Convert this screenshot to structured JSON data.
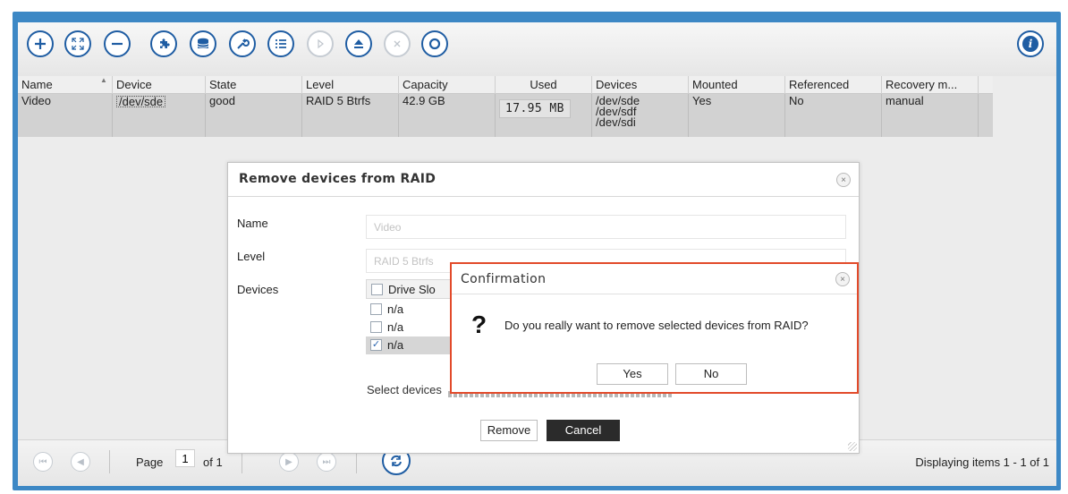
{
  "toolbar": {
    "buttons": [
      {
        "name": "add-icon"
      },
      {
        "name": "expand-icon"
      },
      {
        "name": "remove-icon"
      },
      {
        "name": "puzzle-icon"
      },
      {
        "name": "database-icon"
      },
      {
        "name": "wrench-icon"
      },
      {
        "name": "list-icon"
      },
      {
        "name": "play-icon"
      },
      {
        "name": "eject-icon"
      },
      {
        "name": "cancel-icon"
      },
      {
        "name": "refresh-icon"
      }
    ],
    "info_icon": "info-icon",
    "info_glyph": "i"
  },
  "grid": {
    "columns": [
      "Name",
      "Device",
      "State",
      "Level",
      "Capacity",
      "Used",
      "Devices",
      "Mounted",
      "Referenced",
      "Recovery m..."
    ],
    "rows": [
      {
        "name": "Video",
        "device": "/dev/sde",
        "state": "good",
        "level": "RAID 5 Btrfs",
        "capacity": "42.9 GB",
        "used": "17.95 MB",
        "devices": [
          "/dev/sde",
          "/dev/sdf",
          "/dev/sdi"
        ],
        "mounted": "Yes",
        "referenced": "No",
        "recovery": "manual"
      }
    ]
  },
  "pager": {
    "page_label": "Page",
    "page_value": "1",
    "of_label": "of 1",
    "display_text": "Displaying items 1 - 1 of 1"
  },
  "remove_dialog": {
    "title": "Remove devices from RAID",
    "name_label": "Name",
    "name_value": "Video",
    "level_label": "Level",
    "level_value": "RAID 5 Btrfs",
    "devices_label": "Devices",
    "table_header": "Drive Slo",
    "device_rows": [
      {
        "label": "n/a",
        "checked": false
      },
      {
        "label": "n/a",
        "checked": false
      },
      {
        "label": "n/a",
        "checked": true
      }
    ],
    "hint": "Select devices",
    "remove_button": "Remove",
    "cancel_button": "Cancel",
    "close_glyph": "×"
  },
  "confirmation": {
    "title": "Confirmation",
    "icon": "question-icon",
    "icon_glyph": "?",
    "message": "Do you really want to remove selected devices from RAID?",
    "yes_button": "Yes",
    "no_button": "No",
    "close_glyph": "×"
  },
  "colors": {
    "accent": "#1f5da3",
    "frame": "#3d88c5",
    "highlight_border": "#e24a2a"
  }
}
